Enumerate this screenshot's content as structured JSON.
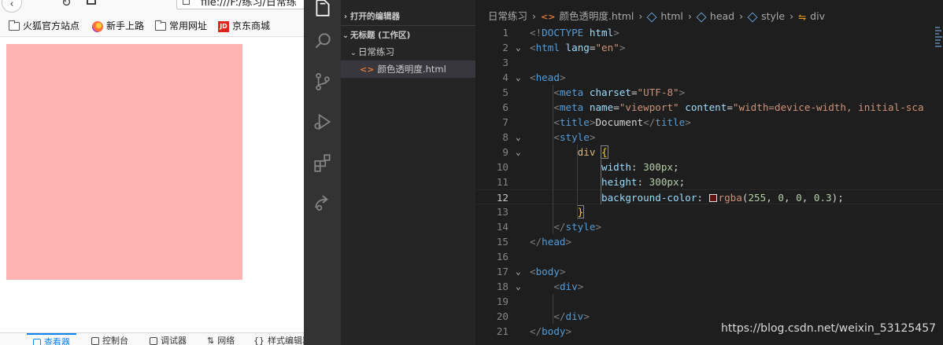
{
  "browser": {
    "url": "file:///F:/练习/日常练",
    "bookmarks": [
      {
        "label": "火狐官方站点",
        "icon": "folder-icon"
      },
      {
        "label": "新手上路",
        "icon": "firefox-icon"
      },
      {
        "label": "常用网址",
        "icon": "folder-icon"
      },
      {
        "label": "京东商城",
        "icon": "jd-icon",
        "icon_text": "JD"
      }
    ],
    "demo_div_color": "rgba(255, 0, 0, 0.3)",
    "devtools_tabs": [
      {
        "label": "查看器",
        "active": true
      },
      {
        "label": "控制台"
      },
      {
        "label": "调试器"
      },
      {
        "label": "网络"
      },
      {
        "label": "样式编辑器"
      }
    ]
  },
  "activitybar": {
    "icons": [
      "explorer-icon",
      "search-icon",
      "source-control-icon",
      "run-debug-icon",
      "extensions-icon",
      "live-share-icon"
    ]
  },
  "sidebar": {
    "open_editors": "打开的编辑器",
    "workspace": "无标题 (工作区)",
    "folder": "日常练习",
    "file": "颜色透明度.html"
  },
  "breadcrumb": {
    "items": [
      "日常练习",
      "颜色透明度.html",
      "html",
      "head",
      "style",
      "div"
    ]
  },
  "editor": {
    "current_line": 12,
    "lines": [
      [
        {
          "c": "t-punc",
          "t": "<!"
        },
        {
          "c": "t-tag",
          "t": "DOCTYPE"
        },
        {
          "c": "t-text",
          "t": " "
        },
        {
          "c": "t-attr",
          "t": "html"
        },
        {
          "c": "t-punc",
          "t": ">"
        }
      ],
      [
        {
          "c": "t-punc",
          "t": "<"
        },
        {
          "c": "t-tag",
          "t": "html"
        },
        {
          "c": "t-text",
          "t": " "
        },
        {
          "c": "t-attr",
          "t": "lang"
        },
        {
          "c": "t-text",
          "t": "="
        },
        {
          "c": "t-str",
          "t": "\"en\""
        },
        {
          "c": "t-punc",
          "t": ">"
        }
      ],
      [],
      [
        {
          "c": "t-punc",
          "t": "<"
        },
        {
          "c": "t-tag",
          "t": "head"
        },
        {
          "c": "t-punc",
          "t": ">"
        }
      ],
      [
        {
          "c": "t-text",
          "t": "    "
        },
        {
          "c": "t-punc",
          "t": "<"
        },
        {
          "c": "t-tag",
          "t": "meta"
        },
        {
          "c": "t-text",
          "t": " "
        },
        {
          "c": "t-attr",
          "t": "charset"
        },
        {
          "c": "t-text",
          "t": "="
        },
        {
          "c": "t-str",
          "t": "\"UTF-8\""
        },
        {
          "c": "t-punc",
          "t": ">"
        }
      ],
      [
        {
          "c": "t-text",
          "t": "    "
        },
        {
          "c": "t-punc",
          "t": "<"
        },
        {
          "c": "t-tag",
          "t": "meta"
        },
        {
          "c": "t-text",
          "t": " "
        },
        {
          "c": "t-attr",
          "t": "name"
        },
        {
          "c": "t-text",
          "t": "="
        },
        {
          "c": "t-str",
          "t": "\"viewport\""
        },
        {
          "c": "t-text",
          "t": " "
        },
        {
          "c": "t-attr",
          "t": "content"
        },
        {
          "c": "t-text",
          "t": "="
        },
        {
          "c": "t-str",
          "t": "\"width=device-width, initial-sca"
        }
      ],
      [
        {
          "c": "t-text",
          "t": "    "
        },
        {
          "c": "t-punc",
          "t": "<"
        },
        {
          "c": "t-tag",
          "t": "title"
        },
        {
          "c": "t-punc",
          "t": ">"
        },
        {
          "c": "t-text",
          "t": "Document"
        },
        {
          "c": "t-punc",
          "t": "</"
        },
        {
          "c": "t-tag",
          "t": "title"
        },
        {
          "c": "t-punc",
          "t": ">"
        }
      ],
      [
        {
          "c": "t-text",
          "t": "    "
        },
        {
          "c": "t-punc",
          "t": "<"
        },
        {
          "c": "t-tag",
          "t": "style"
        },
        {
          "c": "t-punc",
          "t": ">"
        }
      ],
      [
        {
          "c": "t-text",
          "t": "        "
        },
        {
          "c": "t-sel",
          "t": "div"
        },
        {
          "c": "t-text",
          "t": " "
        },
        {
          "c": "t-brace",
          "t": "{"
        }
      ],
      [
        {
          "c": "t-text",
          "t": "            "
        },
        {
          "c": "t-attr",
          "t": "width"
        },
        {
          "c": "t-text",
          "t": ": "
        },
        {
          "c": "t-num",
          "t": "300px"
        },
        {
          "c": "t-text",
          "t": ";"
        }
      ],
      [
        {
          "c": "t-text",
          "t": "            "
        },
        {
          "c": "t-attr",
          "t": "height"
        },
        {
          "c": "t-text",
          "t": ": "
        },
        {
          "c": "t-num",
          "t": "300px"
        },
        {
          "c": "t-text",
          "t": ";"
        }
      ],
      [
        {
          "c": "t-text",
          "t": "            "
        },
        {
          "c": "t-attr",
          "t": "background-color"
        },
        {
          "c": "t-text",
          "t": ": "
        },
        {
          "c": "swatch",
          "t": ""
        },
        {
          "c": "t-str",
          "t": "rgba"
        },
        {
          "c": "t-text",
          "t": "("
        },
        {
          "c": "t-num",
          "t": "255"
        },
        {
          "c": "t-text",
          "t": ", "
        },
        {
          "c": "t-num",
          "t": "0"
        },
        {
          "c": "t-text",
          "t": ", "
        },
        {
          "c": "t-num",
          "t": "0"
        },
        {
          "c": "t-text",
          "t": ", "
        },
        {
          "c": "t-num",
          "t": "0.3"
        },
        {
          "c": "t-text",
          "t": ");"
        }
      ],
      [
        {
          "c": "t-text",
          "t": "        "
        },
        {
          "c": "t-brace",
          "t": "}"
        }
      ],
      [
        {
          "c": "t-text",
          "t": "    "
        },
        {
          "c": "t-punc",
          "t": "</"
        },
        {
          "c": "t-tag",
          "t": "style"
        },
        {
          "c": "t-punc",
          "t": ">"
        }
      ],
      [
        {
          "c": "t-punc",
          "t": "</"
        },
        {
          "c": "t-tag",
          "t": "head"
        },
        {
          "c": "t-punc",
          "t": ">"
        }
      ],
      [],
      [
        {
          "c": "t-punc",
          "t": "<"
        },
        {
          "c": "t-tag",
          "t": "body"
        },
        {
          "c": "t-punc",
          "t": ">"
        }
      ],
      [
        {
          "c": "t-text",
          "t": "    "
        },
        {
          "c": "t-punc",
          "t": "<"
        },
        {
          "c": "t-tag",
          "t": "div"
        },
        {
          "c": "t-punc",
          "t": ">"
        }
      ],
      [],
      [
        {
          "c": "t-text",
          "t": "    "
        },
        {
          "c": "t-punc",
          "t": "</"
        },
        {
          "c": "t-tag",
          "t": "div"
        },
        {
          "c": "t-punc",
          "t": ">"
        }
      ],
      [
        {
          "c": "t-punc",
          "t": "</"
        },
        {
          "c": "t-tag",
          "t": "body"
        },
        {
          "c": "t-punc",
          "t": ">"
        }
      ]
    ],
    "fold_lines": [
      2,
      4,
      8,
      9,
      17,
      18
    ]
  },
  "watermark": "https://blog.csdn.net/weixin_53125457"
}
